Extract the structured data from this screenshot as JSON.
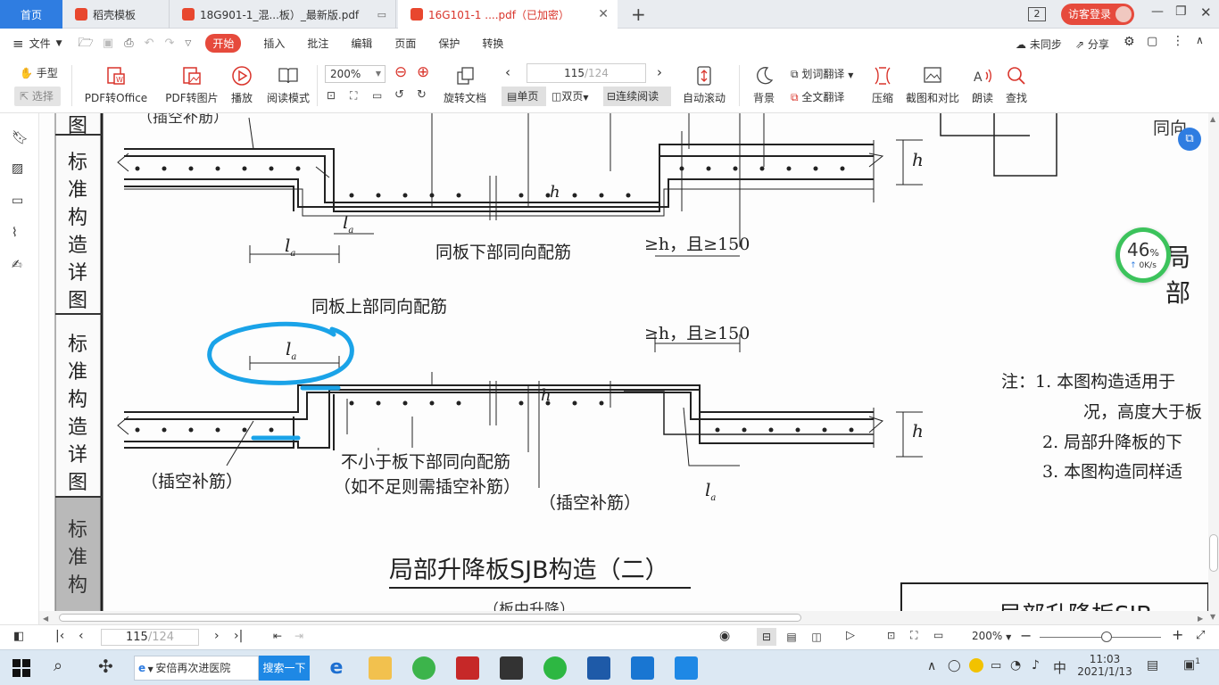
{
  "tabs": {
    "home": "首页",
    "items": [
      {
        "label": "稻壳模板"
      },
      {
        "label": "18G901-1_混...板）_最新版.pdf"
      },
      {
        "label": "16G101-1 ....pdf（已加密）"
      }
    ],
    "window_count": "2",
    "login": "访客登录"
  },
  "menu": {
    "file": "文件",
    "start": "开始",
    "insert": "插入",
    "annotate": "批注",
    "edit": "编辑",
    "page": "页面",
    "protect": "保护",
    "convert": "转换",
    "sync": "未同步",
    "share": "分享"
  },
  "toolbar": {
    "hand": "手型",
    "select": "选择",
    "pdf2office": "PDF转Office",
    "pdf2img": "PDF转图片",
    "play": "播放",
    "read_mode": "阅读模式",
    "zoom": "200%",
    "page_input": "115",
    "page_total": "/124",
    "rotate": "旋转文档",
    "single": "单页",
    "double": "双页",
    "continuous": "连续阅读",
    "autoscroll": "自动滚动",
    "background": "背景",
    "word_translate": "划词翻译",
    "full_translate": "全文翻译",
    "compress": "压缩",
    "compare": "截图和对比",
    "read_aloud": "朗读",
    "find": "查找"
  },
  "doc": {
    "side_label_1": "标准构造详图",
    "side_label_2": "标准构造详图",
    "side_label_3": "标准构",
    "top_clip": "图",
    "fill_top": "（插空补筋）",
    "lower_same": "同板下部同向配筋",
    "cond1": "≥h，且≥150",
    "upper_same": "同板上部同向配筋",
    "cond2": "≥h，且≥150",
    "fill_left": "（插空补筋）",
    "not_less": "不小于板下部同向配筋",
    "if_not": "（如不足则需插空补筋）",
    "fill_mid": "（插空补筋）",
    "la": "l",
    "la_sub": "a",
    "h": "h",
    "title": "局部升降板SJB构造（二）",
    "subtitle": "（板中升降）",
    "right_title": "局部",
    "right_top": "同向",
    "note1": "注：1. 本图构造适用于",
    "note1b": "况，高度大于板",
    "note2": "2. 局部升降板的下",
    "note3": "3. 本图构造同样适",
    "bottom_right": "局部升降板SJB"
  },
  "speed": {
    "percent": "46",
    "unit": "%",
    "rate": "0K/s"
  },
  "status": {
    "page_input": "115",
    "page_total": "/124",
    "zoom": "200%"
  },
  "taskbar": {
    "search_text": "安倍再次进医院",
    "search_button": "搜索一下",
    "ime": "中",
    "time": "11:03",
    "date": "2021/1/13",
    "notif": "1"
  }
}
